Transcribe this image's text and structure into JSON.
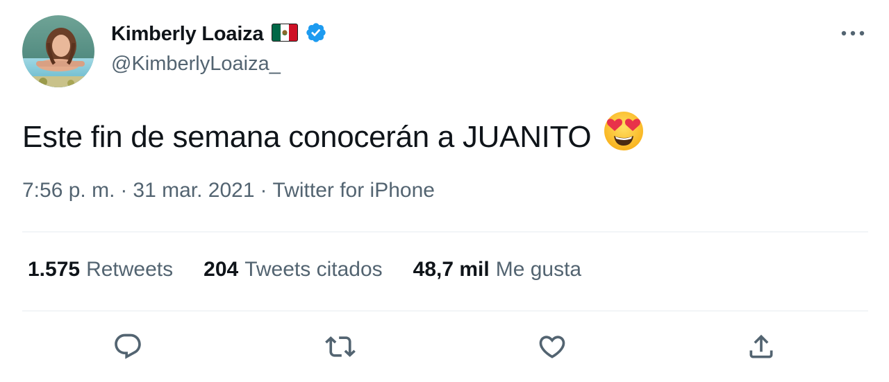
{
  "author": {
    "display_name": "Kimberly Loaiza",
    "handle": "@KimberlyLoaiza_",
    "flag_icon": "mexico-flag-icon",
    "verified_icon": "verified-badge-icon"
  },
  "tweet": {
    "text": "Este fin de semana conocerán a JUANITO",
    "emoji": "smiling-face-with-heart-eyes-emoji"
  },
  "meta": {
    "time": "7:56 p. m.",
    "separator": "·",
    "date": "31 mar. 2021",
    "source": "Twitter for iPhone"
  },
  "stats": {
    "retweets": {
      "count": "1.575",
      "label": "Retweets"
    },
    "quotes": {
      "count": "204",
      "label": "Tweets citados"
    },
    "likes": {
      "count": "48,7 mil",
      "label": "Me gusta"
    }
  },
  "actions": {
    "reply_icon": "reply-icon",
    "retweet_icon": "retweet-icon",
    "like_icon": "heart-icon",
    "share_icon": "share-icon"
  },
  "colors": {
    "text_primary": "#0f1419",
    "text_secondary": "#536471",
    "verified_blue": "#1d9bf0",
    "divider": "#e6ecf0"
  }
}
